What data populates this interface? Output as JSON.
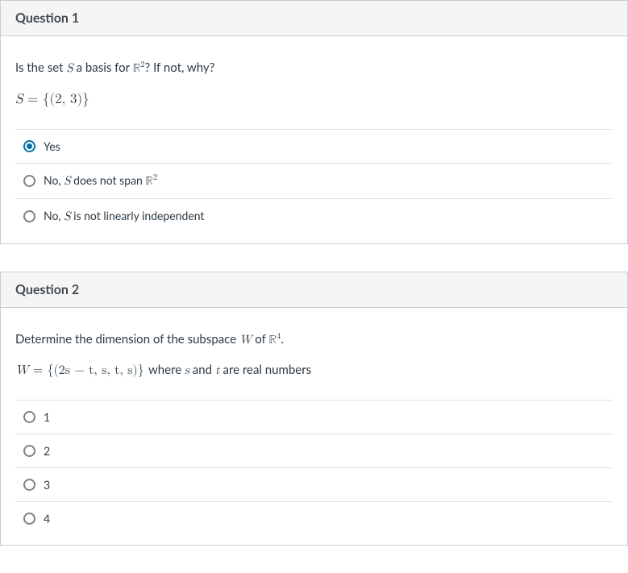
{
  "q1": {
    "header": "Question 1",
    "prompt_pre": "Is the set ",
    "prompt_mid": " a basis for ",
    "prompt_post": "? If not, why?",
    "set_def_lhs": "S",
    "set_def_eq": " = ",
    "set_def_rhs": "{(2, 3)}",
    "options": {
      "a": {
        "text": "Yes",
        "selected": true
      },
      "b": {
        "pre": "No, ",
        "var": "S",
        "mid": " does not span "
      },
      "c": {
        "pre": "No, ",
        "var": "S",
        "post": " is not linearly independent"
      }
    }
  },
  "q2": {
    "header": "Question 2",
    "prompt_pre": "Determine the dimension of the subspace ",
    "prompt_mid": " of ",
    "prompt_post": ".",
    "w_lhs": "W",
    "w_eq": " = ",
    "w_set": "{(2s − t, s, t, s)}",
    "w_tail_pre": " where ",
    "w_var1": "s",
    "w_tail_mid": " and ",
    "w_var2": "t",
    "w_tail_post": " are real numbers",
    "options": {
      "a": "1",
      "b": "2",
      "c": "3",
      "d": "4"
    }
  }
}
